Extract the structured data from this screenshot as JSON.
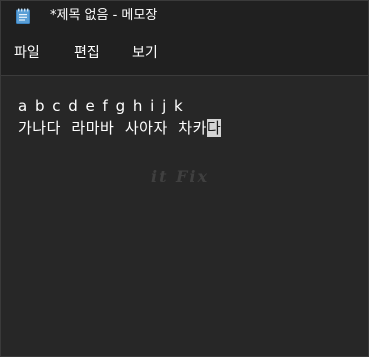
{
  "window": {
    "title": "*제목 없음 - 메모장",
    "icon": "notepad-icon"
  },
  "menu": {
    "items": [
      {
        "label": "파일"
      },
      {
        "label": "편집"
      },
      {
        "label": "보기"
      }
    ]
  },
  "editor": {
    "line1": "a b c d e f g h i j k",
    "line2_text": "가나다  라마바  사아자  차카",
    "line2_selected": "다"
  },
  "watermark": {
    "text": "it Fix"
  },
  "colors": {
    "background": "#272727",
    "titlebar": "#202020",
    "text": "#ffffff",
    "selection": "#d4d4d4"
  }
}
